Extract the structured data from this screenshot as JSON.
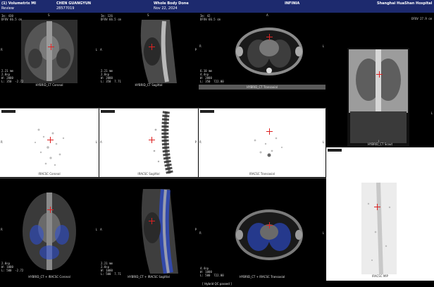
{
  "header": {
    "app_title": "(1) Volumetrix MI",
    "app_subtitle": "Review",
    "patient_name": "CHEN GUANGYUN",
    "patient_id": "28577019",
    "study": "Whole Body Done",
    "study_date": "Nov 22, 2024",
    "device": "INFINIA",
    "hospital": "Shanghai HuaShan Hospital"
  },
  "row1": [
    {
      "caption": "HYBRID_CT Coronal",
      "info_top": "Im: 430\nDFOV 66.5 cm",
      "info_bottom": "2.21 mm\n2.0sp\nW: 2000\nL: 350  -2.72",
      "left": "R",
      "right": "L",
      "top": "S",
      "bottom": "I"
    },
    {
      "caption": "HYBRID_CT Sagittal",
      "info_top": "Im: 126\nDFOV 66.5 cm",
      "info_bottom": "2.21 mm\n2.0sp\nW: 2000\nL: 350  7.71",
      "left": "A",
      "right": "P",
      "top": "S",
      "bottom": "I"
    },
    {
      "caption": "HYBRID_CT Transaxial",
      "info_top": "Im: 42\nDFOV 66.5 cm",
      "info_bottom": "6.10 mm\n4.4sp\nW: 2000\nL: 350  722.00",
      "left": "R",
      "right": "L",
      "top": "A",
      "bottom": "P"
    }
  ],
  "row2": [
    {
      "caption": "IRACSC Coronal",
      "left": "R",
      "right": "L",
      "top": "S",
      "bottom": "I"
    },
    {
      "caption": "IRACSC Sagittal",
      "left": "A",
      "right": "P",
      "top": "S",
      "bottom": "I"
    },
    {
      "caption": "IRACSC Transaxial",
      "left": "R",
      "right": "L",
      "top": "A",
      "bottom": "P"
    }
  ],
  "row3": [
    {
      "caption": "HYBRID_CT + IRACSC Coronal",
      "info_bottom": "2.0sp\nW: 1000\nL: 500  -2.72",
      "left": "R",
      "right": "L",
      "top": "S",
      "bottom": "I"
    },
    {
      "caption": "HYBRID_CT + IRACSC Sagittal",
      "info_bottom": "2.21 mm\n2.0sp\nW: 1000\nL: 500  7.71",
      "left": "A",
      "right": "P",
      "top": "S",
      "bottom": "I"
    },
    {
      "caption": "HYBRID_CT + IRACSC Transaxial",
      "info_bottom": "4.4sp\nW: 1000\nL: 500  722.00",
      "left": "R",
      "right": "L",
      "top": "A",
      "bottom": "P"
    }
  ],
  "side": {
    "scout_caption": "HYBRID_CT Scout",
    "scout_info": "DFOV 27.9 cm",
    "mip_caption": "IRACSC MIP",
    "scout_right": "L",
    "scout_bottom": "I"
  },
  "footer": {
    "qc": "[ Hybrid QC passed ]"
  },
  "colors": {
    "header_bg": "#1d2a6e",
    "crosshair": "#dd2222",
    "fusion_blue": "#2d4fd8"
  }
}
